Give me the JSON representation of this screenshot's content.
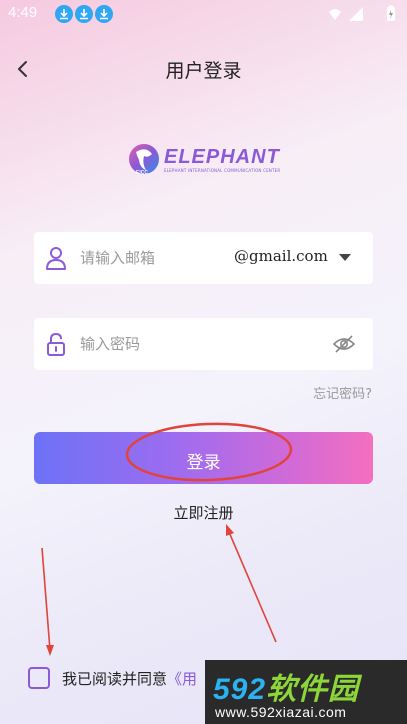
{
  "status_bar": {
    "time": "4:49",
    "download_icons": [
      "download-icon",
      "download-icon",
      "download-icon"
    ],
    "right_icons": [
      "wifi-icon",
      "signal-icon",
      "battery-icon"
    ]
  },
  "header": {
    "title": "用户登录",
    "back_icon": "chevron-left-icon"
  },
  "logo": {
    "text": "ELEPHANT",
    "subtitle": "ELEPHANT INTERNATIONAL COMMUNICATION CENTER",
    "mark_text": "EICC"
  },
  "email_field": {
    "icon": "user-icon",
    "placeholder": "请输入邮箱",
    "domain": "@gmail.com",
    "dropdown_icon": "caret-down-icon"
  },
  "password_field": {
    "icon": "lock-icon",
    "placeholder": "输入密码",
    "visibility_icon": "eye-off-icon"
  },
  "forgot_password": "忘记密码?",
  "login_button": "登录",
  "register_link": "立即注册",
  "agreement": {
    "text": "我已阅读并同意",
    "link": "《用"
  },
  "watermark": {
    "number": "592",
    "name": "软件园",
    "url": "www.592xiazai.com"
  },
  "colors": {
    "accent": "#8a5ad8",
    "button_start": "#6d72f6",
    "button_end": "#f46fbf",
    "annotation_red": "#e0443a"
  }
}
